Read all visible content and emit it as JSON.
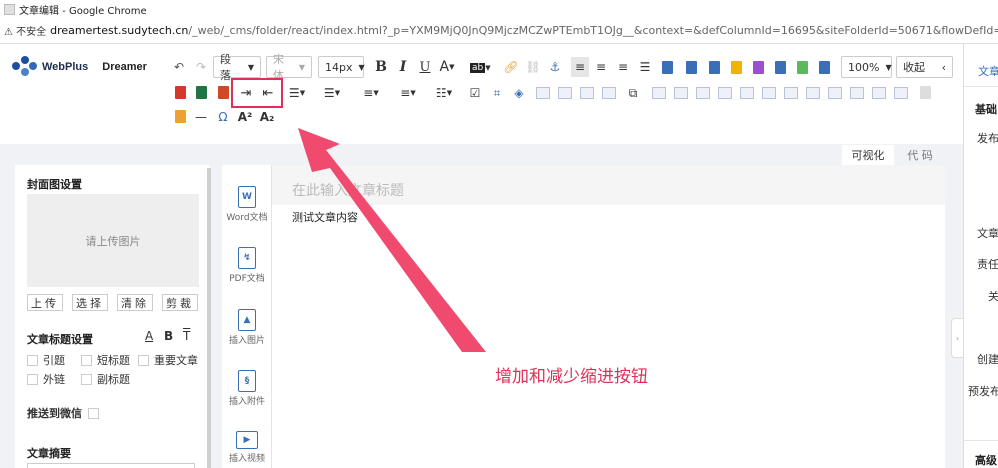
{
  "browser": {
    "window_title": "文章编辑 - Google Chrome",
    "security_label": "不安全",
    "url_host": "dreamertest.sudytech.cn",
    "url_path": "/_web/_cms/folder/react/index.html?_p=YXM9MjQ0JnQ9MjczMCZwPTEmbT1OJg__&context=&defColumnId=16695&siteFolderId=50671&flowDefId=0&act=add&artTyp"
  },
  "logo": {
    "brand": "WebPlus",
    "product": "Dreamer"
  },
  "toolbar": {
    "paragraph_select": "段落",
    "font_select": "宋体",
    "size_select": "14px",
    "bold": "B",
    "italic": "I",
    "underline": "U",
    "font_color": "A",
    "bg_color": "ab",
    "zoom_select": "100%",
    "collapse_button": "收起",
    "superscript": "A²",
    "subscript": "A₂",
    "omega": "Ω"
  },
  "view_tabs": {
    "visual": "可视化",
    "code": "代 码"
  },
  "left_panel": {
    "cover_title": "封面图设置",
    "upload_placeholder": "请上传图片",
    "buttons": {
      "upload": "上传",
      "select": "选择",
      "clear": "清除",
      "crop": "剪裁"
    },
    "title_settings": "文章标题设置",
    "title_format": {
      "underline": "A",
      "bold": "B",
      "strike": "T"
    },
    "options": {
      "quote": "引题",
      "short_title": "短标题",
      "important": "重要文章",
      "external_link": "外链",
      "subtitle": "副标题"
    },
    "push_wechat": "推送到微信",
    "summary": "文章摘要"
  },
  "attachments": [
    {
      "label": "Word文档",
      "icon": "W"
    },
    {
      "label": "PDF文档",
      "icon": "PDF"
    },
    {
      "label": "插入图片",
      "icon": "IMG"
    },
    {
      "label": "插入附件",
      "icon": "ATT"
    },
    {
      "label": "插入视频",
      "icon": "VID"
    }
  ],
  "editor": {
    "title_placeholder": "在此输入文章标题",
    "content": "测试文章内容"
  },
  "annotation": "增加和减少缩进按钮",
  "right_panel": {
    "tab": "文章",
    "basic": "基础",
    "publish": "发布",
    "article": "文章",
    "responsible": "责任",
    "related": "关",
    "create": "创建",
    "pre_publish": "预发布",
    "advanced": "高级"
  },
  "colors": {
    "accent": "#3a6fb7",
    "annotation": "#e0305a",
    "word_blue": "#2b5797",
    "pdf_red": "#d4372c",
    "ppt_orange": "#d24726",
    "excel_green": "#217346"
  }
}
